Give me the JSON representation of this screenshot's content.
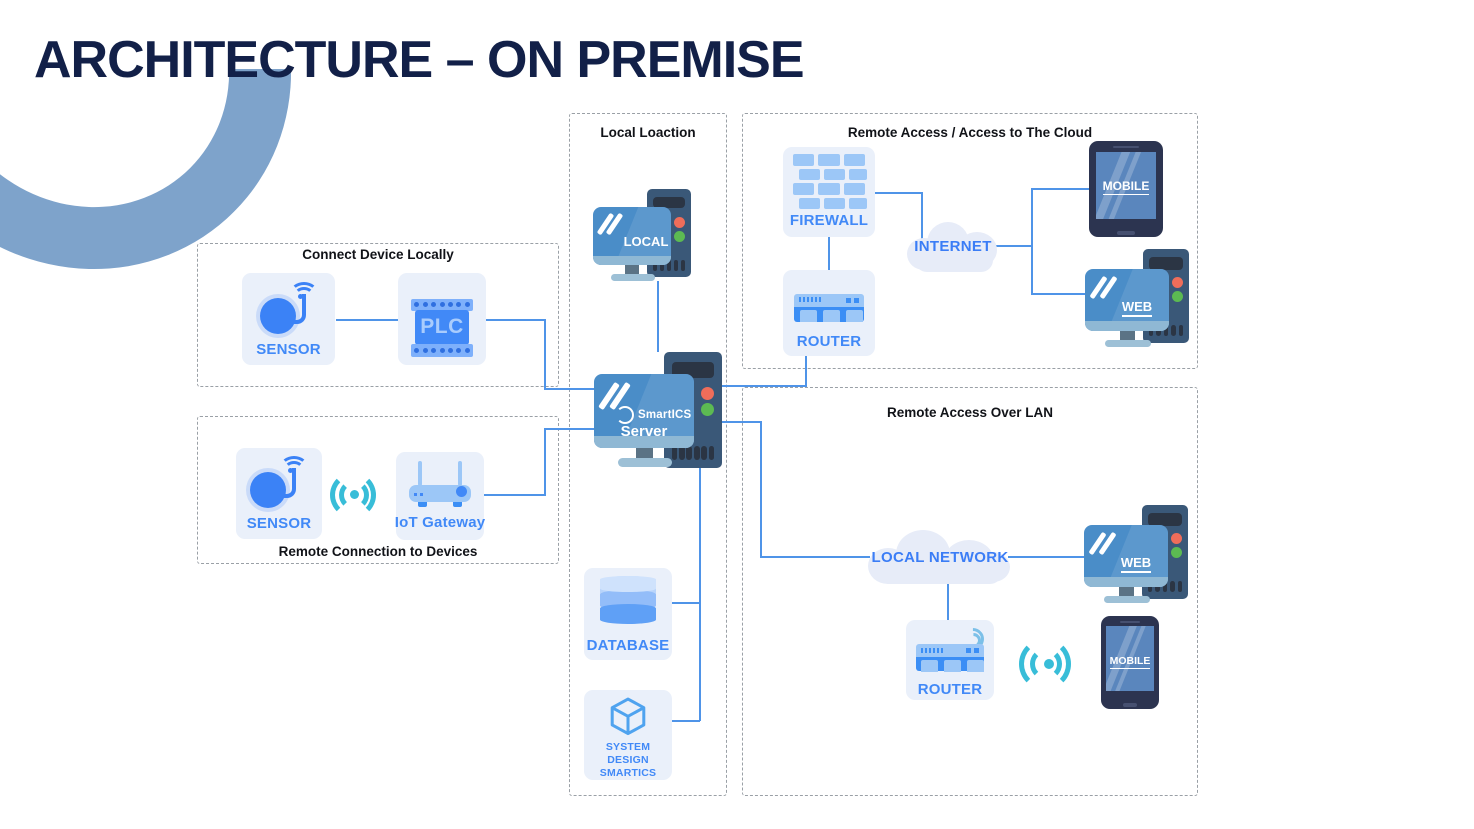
{
  "page": {
    "title": "ARCHITECTURE – ON PREMISE",
    "background": "#ffffff",
    "accent_blue": "#4189f7",
    "line_blue": "#4f94e8",
    "title_color": "#122048",
    "arc_color": "#7ea3cb"
  },
  "groups": [
    {
      "id": "connect-device-locally",
      "title": "Connect Device Locally"
    },
    {
      "id": "remote-connection-to-devices",
      "title": "Remote Connection to Devices"
    },
    {
      "id": "local-location",
      "title": "Local Loaction"
    },
    {
      "id": "remote-access-cloud",
      "title": "Remote Access / Access to The Cloud"
    },
    {
      "id": "remote-access-lan",
      "title": "Remote Access Over LAN"
    }
  ],
  "nodes": {
    "sensor_local": {
      "label": "SENSOR",
      "icon": "sensor-icon"
    },
    "plc": {
      "label": "PLC",
      "icon": "plc-icon"
    },
    "sensor_remote": {
      "label": "SENSOR",
      "icon": "sensor-icon"
    },
    "iot_gateway": {
      "label": "IoT Gateway",
      "icon": "iot-gateway-icon"
    },
    "local_pc": {
      "label": "LOCAL",
      "icon": "desktop-computer-icon"
    },
    "server": {
      "brand": "SmartICS",
      "label": "Server",
      "icon": "server-icon"
    },
    "database": {
      "label": "DATABASE",
      "icon": "database-icon"
    },
    "system_design": {
      "label_line1": "SYSTEM DESIGN",
      "label_line2": "SMARTICS",
      "icon": "cube-icon"
    },
    "firewall": {
      "label": "FIREWALL",
      "icon": "firewall-icon"
    },
    "router_cloud": {
      "label": "ROUTER",
      "icon": "router-icon"
    },
    "internet": {
      "label": "INTERNET",
      "icon": "cloud-icon"
    },
    "mobile_cloud": {
      "label": "MOBILE",
      "icon": "mobile-phone-icon"
    },
    "web_cloud": {
      "label": "WEB",
      "icon": "desktop-computer-icon"
    },
    "local_network": {
      "label": "LOCAL NETWORK",
      "icon": "cloud-icon"
    },
    "web_lan": {
      "label": "WEB",
      "icon": "desktop-computer-icon"
    },
    "router_lan": {
      "label": "ROUTER",
      "icon": "router-icon"
    },
    "mobile_lan": {
      "label": "MOBILE",
      "icon": "mobile-phone-icon"
    },
    "wireless_remote": {
      "icon": "wireless-signal-icon"
    },
    "wireless_lan": {
      "icon": "wireless-signal-icon"
    }
  }
}
